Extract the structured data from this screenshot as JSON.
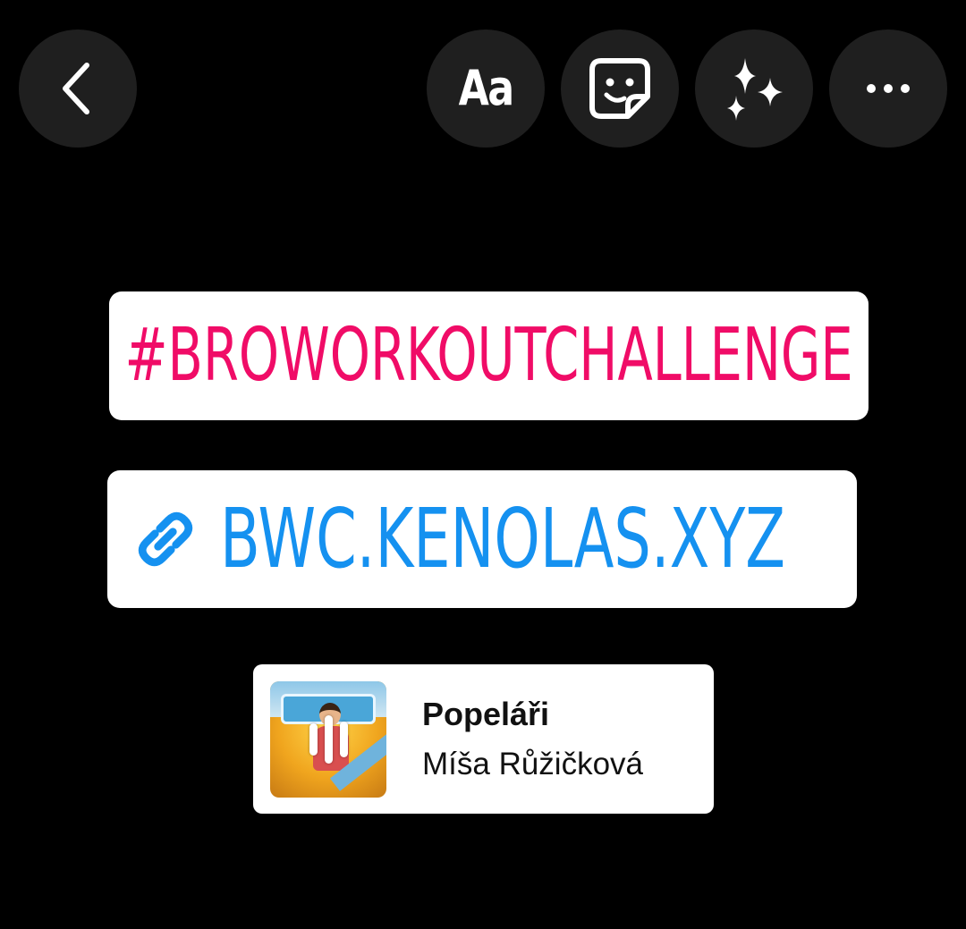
{
  "toolbar": {
    "back_icon": "chevron-left-icon",
    "text_tool_label": "Aa",
    "sticker_icon": "sticker-icon",
    "effects_icon": "sparkles-icon",
    "more_icon": "more-horizontal-icon"
  },
  "stickers": {
    "hashtag": {
      "text": "#BROWORKOUTCHALLENGE",
      "color": "#f00c67"
    },
    "link": {
      "icon": "link-icon",
      "text": "BWC.KENOLAS.XYZ",
      "color": "#1591f0"
    },
    "music": {
      "album_art_icon": "album-art",
      "playing_indicator_icon": "audio-bars-icon",
      "song_title": "Popeláři",
      "artist": "Míša Růžičková"
    }
  },
  "colors": {
    "background": "#000000",
    "button_background": "#1f1f1f",
    "sticker_background": "#ffffff"
  }
}
